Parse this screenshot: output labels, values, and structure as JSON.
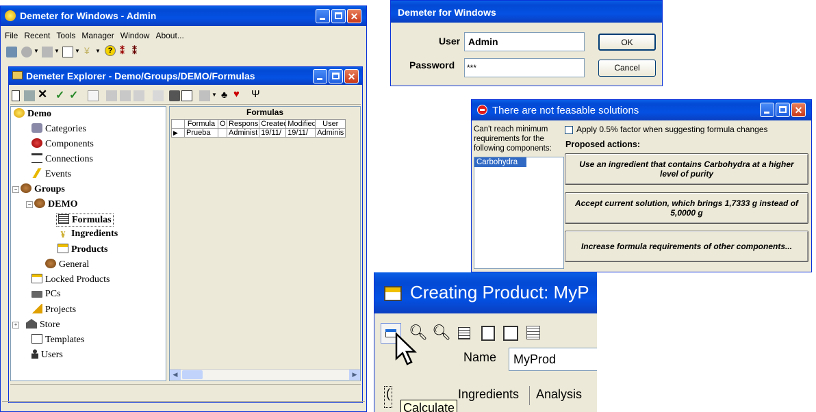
{
  "main_window": {
    "title": "Demeter for Windows - Admin",
    "menu": [
      "File",
      "Recent",
      "Tools",
      "Manager",
      "Window",
      "About..."
    ]
  },
  "explorer": {
    "title": "Demeter Explorer - Demo/Groups/DEMO/Formulas",
    "tree": {
      "root": "Demo",
      "items": [
        "Categories",
        "Components",
        "Connections",
        "Events"
      ],
      "groups": "Groups",
      "demo": "DEMO",
      "demo_children": [
        "Formulas",
        "Ingredients",
        "Products"
      ],
      "general": "General",
      "tail": [
        "Locked Products",
        "PCs",
        "Projects",
        "Store",
        "Templates",
        "Users"
      ]
    },
    "grid": {
      "title": "Formulas",
      "columns": [
        "Formula",
        "O",
        "Respons",
        "Created",
        "Modified",
        "User"
      ],
      "rows": [
        [
          "Prueba",
          "",
          "Administ",
          "19/11/",
          "19/11/",
          "Adminis"
        ]
      ]
    }
  },
  "login": {
    "title": "Demeter for Windows",
    "user_label": "User",
    "user_value": "Admin",
    "password_label": "Password",
    "password_value": "***",
    "ok": "OK",
    "cancel": "Cancel"
  },
  "solutions": {
    "title": "There are not feasable solutions",
    "left_text": "Can't reach minimum requirements for the following components:",
    "list_item": "Carbohydra",
    "checkbox_label": "Apply 0.5% factor when suggesting formula changes",
    "proposed": "Proposed actions:",
    "actions": [
      "Use an ingredient that contains Carbohydra at a higher level of purity",
      "Accept current solution, which brings 1,7333 g instead of 5,0000 g",
      "Increase formula requirements of other components..."
    ]
  },
  "product": {
    "title": "Creating Product: MyP",
    "name_label": "Name",
    "name_value": "MyProd",
    "tooltip": "Calculate",
    "tabs": [
      "Ingredients",
      "Analysis"
    ],
    "tab_partial": "("
  },
  "colors": {
    "xp_blue": "#0451e3",
    "xp_face": "#ece9d8",
    "selection": "#316ac5"
  }
}
